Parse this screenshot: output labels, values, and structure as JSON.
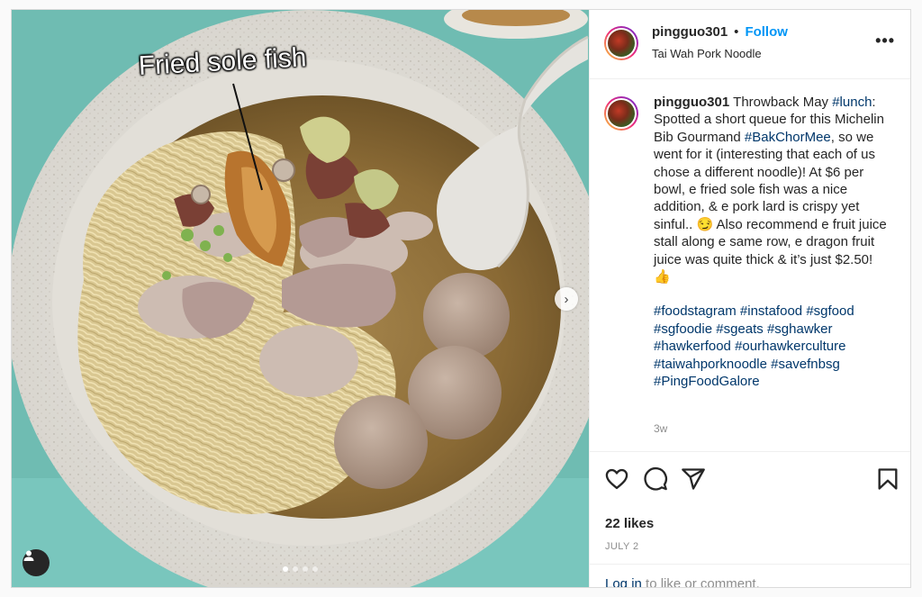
{
  "post": {
    "image": {
      "overlay_text": "Fried sole fish",
      "next_icon": "chevron-right-icon",
      "tag_icon": "user-tag-icon",
      "carousel_dots": 4,
      "active_dot": 0
    },
    "header": {
      "username": "pingguo301",
      "separator": "•",
      "follow_label": "Follow",
      "location": "Tai Wah Pork Noodle",
      "more_icon": "•••"
    },
    "caption": {
      "username": "pingguo301",
      "segments": [
        {
          "t": "Throwback May "
        },
        {
          "t": "#lunch",
          "tag": true
        },
        {
          "t": ": Spotted a short queue for this Michelin Bib Gourmand "
        },
        {
          "t": "#BakChorMee",
          "tag": true
        },
        {
          "t": ", so we went for it (interesting that each of us chose a different noodle)! At $6 per bowl, e fried sole fish was a nice addition, & e pork lard is crispy yet sinful.. 😏 Also recommend e fruit juice stall along e same row, e dragon fruit juice was quite thick & it’s just $2.50! 👍"
        }
      ],
      "hashtags": [
        "#foodstagram",
        "#instafood",
        "#sgfood",
        "#sgfoodie",
        "#sgeats",
        "#sghawker",
        "#hawkerfood",
        "#ourhawkerculture",
        "#taiwahporknoodle",
        "#savefnbsg",
        "#PingFoodGalore"
      ],
      "time_ago": "3w"
    },
    "actions": {
      "icons": [
        "heart-icon",
        "comment-icon",
        "share-icon",
        "bookmark-icon"
      ],
      "likes": "22 likes",
      "date": "JULY 2"
    },
    "login": {
      "link": "Log in",
      "rest": " to like or comment."
    }
  },
  "colors": {
    "link": "#0095f6",
    "hashtag": "#00376b",
    "muted": "#8e8e8e",
    "text": "#262626"
  }
}
